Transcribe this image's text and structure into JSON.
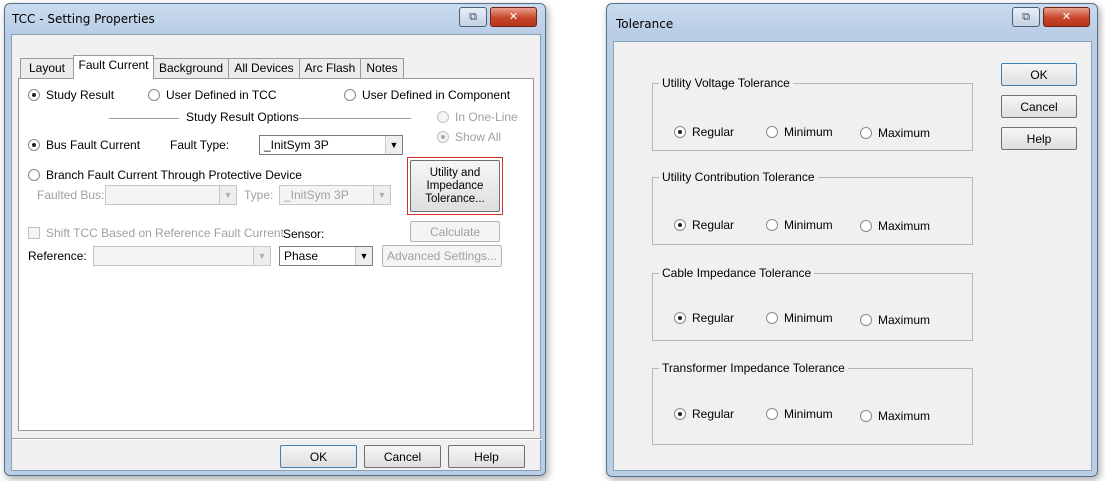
{
  "tcc_window": {
    "title": "TCC - Setting Properties",
    "restore_glyph": "⧉",
    "close_glyph": "✕",
    "tabs": [
      {
        "label": "Layout"
      },
      {
        "label": "Fault Current"
      },
      {
        "label": "Background"
      },
      {
        "label": "All Devices"
      },
      {
        "label": "Arc Flash"
      },
      {
        "label": "Notes"
      }
    ],
    "active_tab": "Fault Current",
    "source": {
      "study_result": "Study Result",
      "user_defined_tcc": "User Defined in TCC",
      "user_defined_component": "User Defined in Component",
      "selected": "Study Result"
    },
    "study_result_options_label": "Study Result Options",
    "in_one_line": "In One-Line",
    "show_all": "Show All",
    "bus_fault_current": "Bus Fault Current",
    "fault_type_label": "Fault Type:",
    "fault_type_value": "_InitSym 3P",
    "branch_fault_current": "Branch Fault Current Through Protective Device",
    "faulted_bus_label": "Faulted Bus:",
    "faulted_bus_value": "",
    "type_label": "Type:",
    "type_value": "_InitSym 3P",
    "utility_button_line1": "Utility and",
    "utility_button_line2": "Impedance",
    "utility_button_line3": "Tolerance...",
    "calculate_button": "Calculate",
    "shift_tcc": "Shift TCC Based on Reference Fault Current",
    "sensor_label": "Sensor:",
    "sensor_value": "Phase",
    "reference_label": "Reference:",
    "reference_value": "",
    "advanced_settings_button": "Advanced Settings...",
    "ok_button": "OK",
    "cancel_button": "Cancel",
    "help_button": "Help",
    "highlight_color": "#d9322d"
  },
  "tolerance_window": {
    "title": "Tolerance",
    "restore_glyph": "⧉",
    "close_glyph": "✕",
    "ok_button": "OK",
    "cancel_button": "Cancel",
    "help_button": "Help",
    "groups": [
      {
        "label": "Utility Voltage Tolerance",
        "regular": "Regular",
        "minimum": "Minimum",
        "maximum": "Maximum",
        "selected": "Regular"
      },
      {
        "label": "Utility Contribution Tolerance",
        "regular": "Regular",
        "minimum": "Minimum",
        "maximum": "Maximum",
        "selected": "Regular"
      },
      {
        "label": "Cable Impedance Tolerance",
        "regular": "Regular",
        "minimum": "Minimum",
        "maximum": "Maximum",
        "selected": "Regular"
      },
      {
        "label": "Transformer Impedance Tolerance",
        "regular": "Regular",
        "minimum": "Minimum",
        "maximum": "Maximum",
        "selected": "Regular"
      }
    ]
  }
}
